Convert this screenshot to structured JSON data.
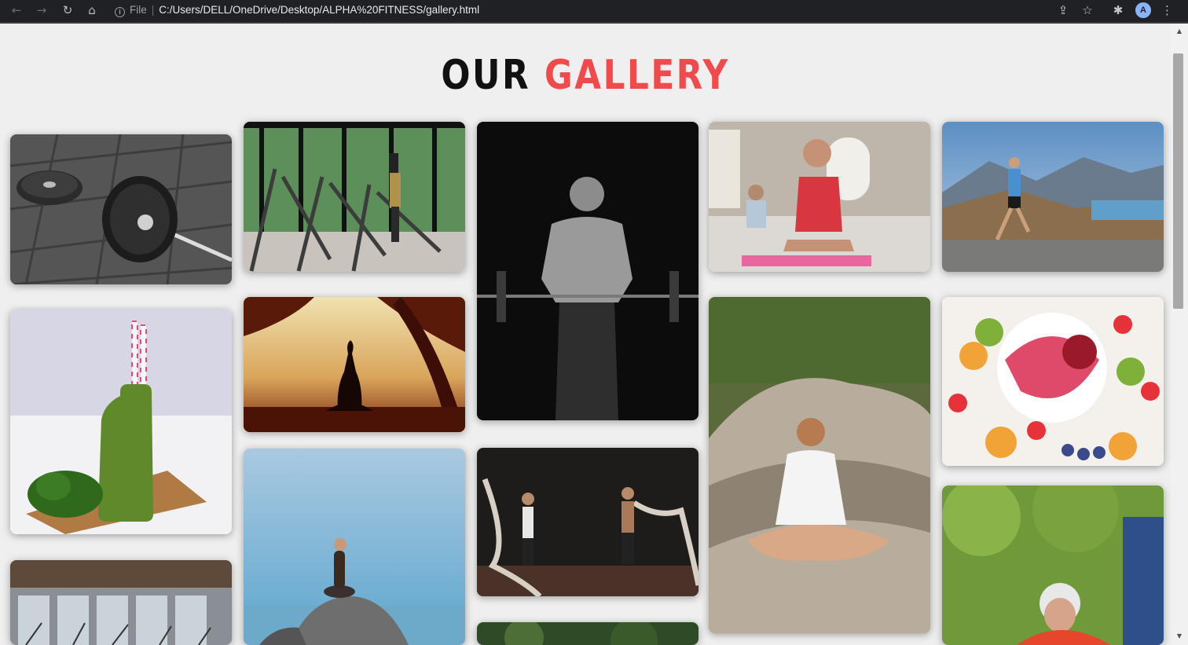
{
  "browser": {
    "info_label": "i",
    "scheme_label": "File",
    "url": "C:/Users/DELL/OneDrive/Desktop/ALPHA%20FITNESS/gallery.html",
    "avatar_initial": "A",
    "icons": [
      "back-icon",
      "forward-icon",
      "reload-icon",
      "home-icon",
      "share-icon",
      "star-icon",
      "extensions-icon",
      "menu-icon"
    ]
  },
  "page": {
    "title_part1": "OUR",
    "title_part2": "GALLERY",
    "accent_color": "#f04a4c"
  },
  "gallery": {
    "images": [
      {
        "id": "barbell-plate"
      },
      {
        "id": "treadmills"
      },
      {
        "id": "bodybuilder-barbell"
      },
      {
        "id": "woman-plank-mat"
      },
      {
        "id": "runner-mountains"
      },
      {
        "id": "green-smoothie"
      },
      {
        "id": "yoga-sunset-silhouette"
      },
      {
        "id": "woman-meditating-log"
      },
      {
        "id": "fruit-bowl"
      },
      {
        "id": "yoga-rock-sea"
      },
      {
        "id": "battle-ropes"
      },
      {
        "id": "gym-interior"
      },
      {
        "id": "older-man-outdoor"
      },
      {
        "id": "outdoor-partial"
      }
    ]
  }
}
